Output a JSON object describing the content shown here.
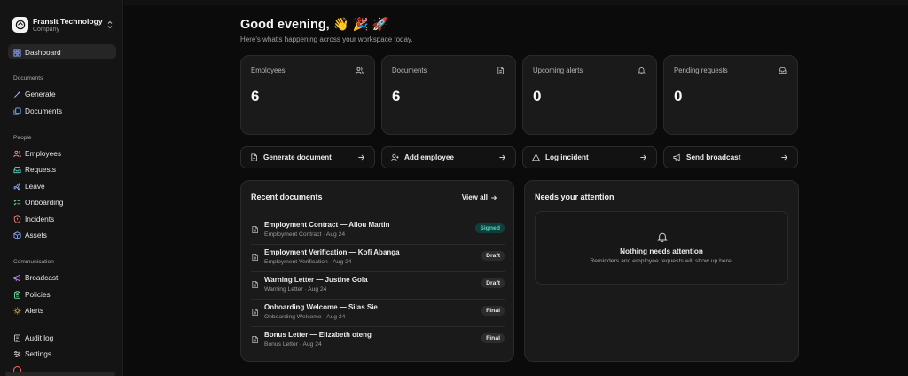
{
  "org": {
    "name": "Fransit Technology",
    "type": "Company"
  },
  "nav": {
    "dashboard": "Dashboard",
    "sections": {
      "documents": "Documents",
      "people": "People",
      "communication": "Communication"
    },
    "documents_items": [
      "Generate",
      "Documents"
    ],
    "people_items": [
      "Employees",
      "Requests",
      "Leave",
      "Onboarding",
      "Incidents",
      "Assets"
    ],
    "communication_items": [
      "Broadcast",
      "Policies",
      "Alerts"
    ],
    "bottom_items": [
      "Audit log",
      "Settings"
    ]
  },
  "greeting": {
    "title": "Good evening, 👋 🎉 🚀",
    "subtitle": "Here's what's happening across your workspace today."
  },
  "stats": [
    {
      "label": "Employees",
      "value": "6",
      "icon": "users-icon"
    },
    {
      "label": "Documents",
      "value": "6",
      "icon": "file-icon"
    },
    {
      "label": "Upcoming alerts",
      "value": "0",
      "icon": "bell-icon"
    },
    {
      "label": "Pending requests",
      "value": "0",
      "icon": "inbox-icon"
    }
  ],
  "actions": [
    {
      "label": "Generate document",
      "icon": "file-plus-icon"
    },
    {
      "label": "Add employee",
      "icon": "user-plus-icon"
    },
    {
      "label": "Log incident",
      "icon": "warning-icon"
    },
    {
      "label": "Send broadcast",
      "icon": "megaphone-icon"
    }
  ],
  "recent": {
    "title": "Recent documents",
    "view_all": "View all",
    "items": [
      {
        "title": "Employment Contract — Allou Martin",
        "sub": "Employment Contract · Aug 24",
        "status": "Signed"
      },
      {
        "title": "Employment Verification — Kofi Abanga",
        "sub": "Employment Verification · Aug 24",
        "status": "Draft"
      },
      {
        "title": "Warning Letter — Justine Gola",
        "sub": "Warning Letter · Aug 24",
        "status": "Draft"
      },
      {
        "title": "Onboarding Welcome — Silas Sie",
        "sub": "Onboarding Welcome · Aug 24",
        "status": "Final"
      },
      {
        "title": "Bonus Letter — Elizabeth oteng",
        "sub": "Bonus Letter · Aug 24",
        "status": "Final"
      }
    ]
  },
  "attention": {
    "title": "Needs your attention",
    "empty_title": "Nothing needs attention",
    "empty_sub": "Reminders and employee requests will show up here."
  },
  "colors": {
    "background": "#0b0b0b",
    "card": "#1a1a1a",
    "signed_badge_bg": "#0f3f3a",
    "signed_badge_text": "#54d8c2"
  }
}
